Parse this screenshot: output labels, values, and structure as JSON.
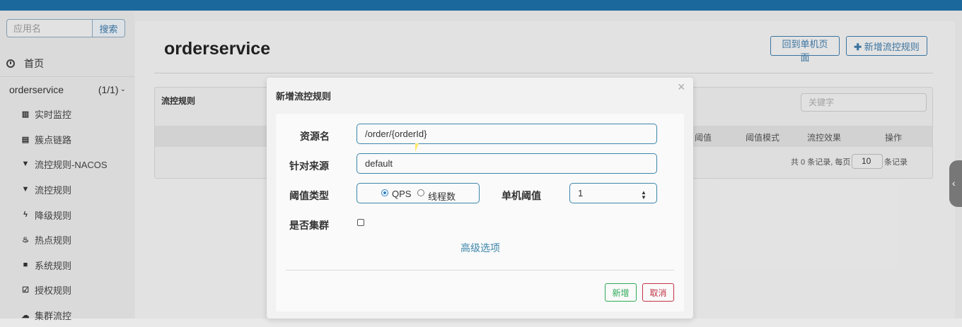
{
  "sidebar": {
    "search_placeholder": "应用名",
    "search_button": "搜索",
    "home": "首页",
    "app": {
      "name": "orderservice",
      "count": "(1/1)"
    },
    "items": [
      {
        "icon": "bar-chart-icon",
        "label": "实时监控"
      },
      {
        "icon": "list-icon",
        "label": "簇点链路"
      },
      {
        "icon": "filter-icon",
        "label": "流控规则-NACOS"
      },
      {
        "icon": "filter-icon",
        "label": "流控规则"
      },
      {
        "icon": "bolt-icon",
        "label": "降级规则"
      },
      {
        "icon": "fire-icon",
        "label": "热点规则"
      },
      {
        "icon": "lock-icon",
        "label": "系统规则"
      },
      {
        "icon": "check-square-icon",
        "label": "授权规则"
      },
      {
        "icon": "cloud-icon",
        "label": "集群流控"
      }
    ]
  },
  "header": {
    "title": "orderservice",
    "back_button": "回到单机页面",
    "add_button_icon": "plus-icon",
    "add_button": "新增流控规则"
  },
  "panel": {
    "title": "流控规则",
    "keyword_placeholder": "关键字",
    "columns": [
      "阈值",
      "阈值模式",
      "流控效果",
      "操作"
    ],
    "pager": {
      "prefix": "共 0 条记录, 每页",
      "page_size": "10",
      "suffix": "条记录"
    }
  },
  "modal": {
    "title": "新增流控规则",
    "close": "×",
    "fields": {
      "resource": {
        "label": "资源名",
        "value": "/order/{orderId}"
      },
      "origin": {
        "label": "针对来源",
        "value": "default"
      },
      "threshold_type": {
        "label": "阈值类型",
        "options": [
          "QPS",
          "线程数"
        ],
        "selected": "QPS"
      },
      "threshold": {
        "label": "单机阈值",
        "value": "1"
      },
      "cluster": {
        "label": "是否集群",
        "checked": false
      }
    },
    "advanced_link": "高级选项",
    "add_button": "新增",
    "cancel_button": "取消"
  }
}
